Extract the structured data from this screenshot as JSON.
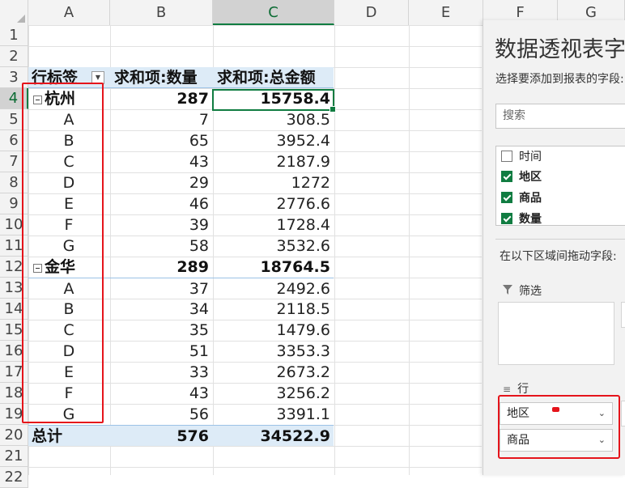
{
  "columns": [
    "A",
    "B",
    "C",
    "D",
    "E",
    "F",
    "G"
  ],
  "rows": [
    "1",
    "2",
    "3",
    "4",
    "5",
    "6",
    "7",
    "8",
    "9",
    "10",
    "11",
    "12",
    "13",
    "14",
    "15",
    "16",
    "17",
    "18",
    "19",
    "20",
    "21",
    "22"
  ],
  "pivot": {
    "headers": {
      "row_label": "行标签",
      "sum_qty": "求和项:数量",
      "sum_amount": "求和项:总金额"
    },
    "groups": [
      {
        "name": "杭州",
        "qty": "287",
        "amount": "15758.4",
        "items": [
          {
            "name": "A",
            "qty": "7",
            "amount": "308.5"
          },
          {
            "name": "B",
            "qty": "65",
            "amount": "3952.4"
          },
          {
            "name": "C",
            "qty": "43",
            "amount": "2187.9"
          },
          {
            "name": "D",
            "qty": "29",
            "amount": "1272"
          },
          {
            "name": "E",
            "qty": "46",
            "amount": "2776.6"
          },
          {
            "name": "F",
            "qty": "39",
            "amount": "1728.4"
          },
          {
            "name": "G",
            "qty": "58",
            "amount": "3532.6"
          }
        ]
      },
      {
        "name": "金华",
        "qty": "289",
        "amount": "18764.5",
        "items": [
          {
            "name": "A",
            "qty": "37",
            "amount": "2492.6"
          },
          {
            "name": "B",
            "qty": "34",
            "amount": "2118.5"
          },
          {
            "name": "C",
            "qty": "35",
            "amount": "1479.6"
          },
          {
            "name": "D",
            "qty": "51",
            "amount": "3353.3"
          },
          {
            "name": "E",
            "qty": "33",
            "amount": "2673.2"
          },
          {
            "name": "F",
            "qty": "43",
            "amount": "3256.2"
          },
          {
            "name": "G",
            "qty": "56",
            "amount": "3391.1"
          }
        ]
      }
    ],
    "total": {
      "label": "总计",
      "qty": "576",
      "amount": "34522.9"
    }
  },
  "panel": {
    "title": "数据透视表字段",
    "subtitle": "选择要添加到报表的字段:",
    "search_placeholder": "搜索",
    "fields": [
      {
        "name": "时间",
        "checked": false
      },
      {
        "name": "地区",
        "checked": true
      },
      {
        "name": "商品",
        "checked": true
      },
      {
        "name": "数量",
        "checked": true
      }
    ],
    "drag_hint": "在以下区域间拖动字段:",
    "filter_label": "筛选",
    "rows_label": "行",
    "row_fields": [
      "地区",
      "商品"
    ]
  },
  "colors": {
    "accent": "#107c41",
    "highlight": "#e5141b",
    "pivot_header": "#ddebf7"
  }
}
